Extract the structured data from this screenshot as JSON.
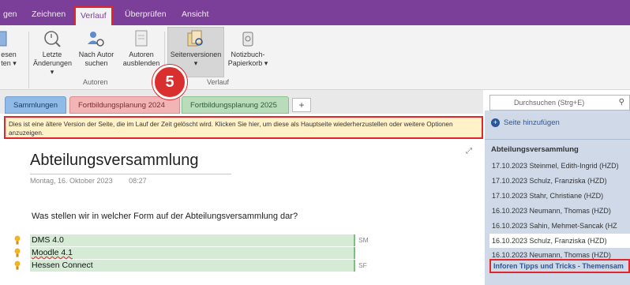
{
  "menu": {
    "tabs": [
      "gen",
      "Zeichnen",
      "Verlauf",
      "Überprüfen",
      "Ansicht"
    ],
    "active": "Verlauf"
  },
  "ribbon": {
    "buttons": [
      {
        "label1": "esen",
        "label2": "ten ▾"
      },
      {
        "label1": "Letzte",
        "label2": "Änderungen ▾"
      },
      {
        "label1": "Nach Autor",
        "label2": "suchen"
      },
      {
        "label1": "Autoren",
        "label2": "ausblenden"
      },
      {
        "label1": "Seitenversionen",
        "label2": "▾"
      },
      {
        "label1": "Notizbuch-",
        "label2": "Papierkorb ▾"
      }
    ],
    "groups": [
      "Autoren",
      "Verlauf"
    ]
  },
  "badge": "5",
  "section_tabs": [
    "Sammlungen",
    "Fortbildungsplanung 2024",
    "Fortbildungsplanung 2025",
    "+"
  ],
  "search": {
    "placeholder": "Durchsuchen (Strg+E)"
  },
  "warning": "Dies ist eine ältere Version der Seite, die im Lauf der Zeit gelöscht wird. Klicken Sie hier, um diese als Hauptseite wiederherzustellen oder weitere Optionen anzuzeigen.",
  "page": {
    "title": "Abteilungsversammlung",
    "date": "Montag, 16. Oktober 2023",
    "time": "08:27",
    "question": "Was stellen wir in welcher Form auf der Abteilungsversammlung dar?",
    "items": [
      {
        "text": "DMS 4.0",
        "initials": "SM"
      },
      {
        "text": "Moodle 4.1",
        "initials": ""
      },
      {
        "text": "Hessen Connect",
        "initials": "SF"
      }
    ]
  },
  "right_pane": {
    "add_page": "Seite hinzufügen",
    "section": "Abteilungsversammlung",
    "versions": [
      "17.10.2023 Steinmel, Edith-Ingrid (HZD)",
      "17.10.2023 Schulz, Franziska (HZD)",
      "17.10.2023 Stahr, Christiane (HZD)",
      "16.10.2023 Neumann, Thomas (HZD)",
      "16.10.2023 Sahin, Mehmet-Sancak (HZ",
      "16.10.2023 Schulz, Franziska (HZD)",
      "16.10.2023 Neumann, Thomas (HZD)"
    ],
    "next_page": "Inforen Tipps und Tricks - Themensam"
  },
  "colors": {
    "accent": "#7b3f99",
    "highlight": "#e0262b",
    "warning_bg": "#fff2c9"
  }
}
